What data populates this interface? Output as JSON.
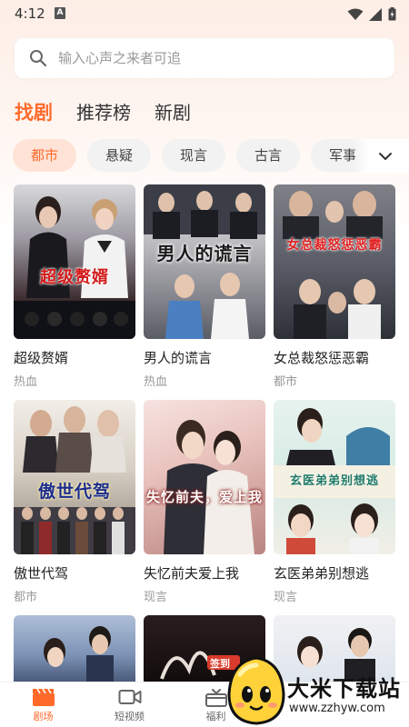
{
  "status_bar": {
    "time": "4:12",
    "notification_badge": "A"
  },
  "search": {
    "placeholder": "输入心声之来者可追"
  },
  "top_tabs": [
    {
      "label": "找剧",
      "active": true
    },
    {
      "label": "推荐榜",
      "active": false
    },
    {
      "label": "新剧",
      "active": false
    }
  ],
  "categories": [
    {
      "label": "都市",
      "active": true
    },
    {
      "label": "悬疑",
      "active": false
    },
    {
      "label": "现言",
      "active": false
    },
    {
      "label": "古言",
      "active": false
    },
    {
      "label": "军事",
      "active": false
    }
  ],
  "dramas": [
    {
      "title": "超级赘婿",
      "tag": "热血",
      "poster_text": "超级赘婿"
    },
    {
      "title": "男人的谎言",
      "tag": "热血",
      "poster_text": "男人的谎言"
    },
    {
      "title": "女总裁怒惩恶霸",
      "tag": "都市",
      "poster_text": "女总裁怒惩恶霸"
    },
    {
      "title": "傲世代驾",
      "tag": "都市",
      "poster_text": "傲世代驾"
    },
    {
      "title": "失忆前夫爱上我",
      "tag": "现言",
      "poster_text": "失忆前夫，爱上我"
    },
    {
      "title": "玄医弟弟别想逃",
      "tag": "现言",
      "poster_text": "玄医弟弟别想逃"
    }
  ],
  "partial_posters": [
    {
      "poster_text": ""
    },
    {
      "poster_text": "签到"
    },
    {
      "poster_text": ""
    }
  ],
  "bottom_nav": [
    {
      "label": "剧场",
      "icon": "clapperboard-icon",
      "active": true
    },
    {
      "label": "短视频",
      "icon": "video-camera-icon",
      "active": false
    },
    {
      "label": "福利",
      "icon": "gift-icon",
      "active": false
    }
  ],
  "watermark": {
    "title": "大米下载站",
    "url": "www.zzhyw.com"
  },
  "colors": {
    "accent": "#ff6a2b",
    "chip_active_bg": "#ffe3d6",
    "chip_bg": "#f2f2f2"
  }
}
